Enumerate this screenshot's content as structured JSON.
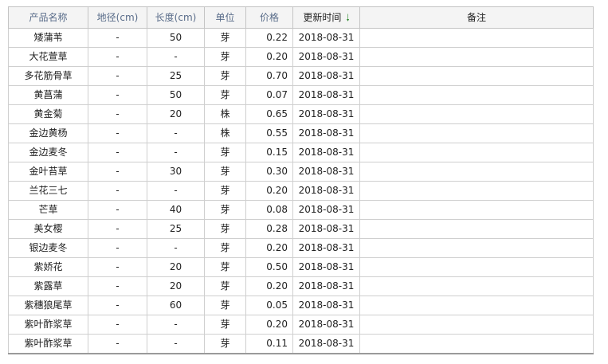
{
  "table": {
    "headers": {
      "name": "产品名称",
      "diameter": "地径(cm)",
      "length": "长度(cm)",
      "unit": "单位",
      "price": "价格",
      "updated": "更新时间",
      "remark": "备注"
    },
    "sort_icon": "arrow-down-icon",
    "sort_color": "#2e8b2e",
    "rows": [
      {
        "name": "矮蒲苇",
        "diameter": "-",
        "length": "50",
        "unit": "芽",
        "price": "0.22",
        "updated": "2018-08-31",
        "remark": ""
      },
      {
        "name": "大花萱草",
        "diameter": "-",
        "length": "-",
        "unit": "芽",
        "price": "0.20",
        "updated": "2018-08-31",
        "remark": ""
      },
      {
        "name": "多花筋骨草",
        "diameter": "-",
        "length": "25",
        "unit": "芽",
        "price": "0.70",
        "updated": "2018-08-31",
        "remark": ""
      },
      {
        "name": "黄菖蒲",
        "diameter": "-",
        "length": "50",
        "unit": "芽",
        "price": "0.07",
        "updated": "2018-08-31",
        "remark": ""
      },
      {
        "name": "黄金菊",
        "diameter": "-",
        "length": "20",
        "unit": "株",
        "price": "0.65",
        "updated": "2018-08-31",
        "remark": ""
      },
      {
        "name": "金边黄杨",
        "diameter": "-",
        "length": "-",
        "unit": "株",
        "price": "0.55",
        "updated": "2018-08-31",
        "remark": ""
      },
      {
        "name": "金边麦冬",
        "diameter": "-",
        "length": "-",
        "unit": "芽",
        "price": "0.15",
        "updated": "2018-08-31",
        "remark": ""
      },
      {
        "name": "金叶苔草",
        "diameter": "-",
        "length": "30",
        "unit": "芽",
        "price": "0.30",
        "updated": "2018-08-31",
        "remark": ""
      },
      {
        "name": "兰花三七",
        "diameter": "-",
        "length": "-",
        "unit": "芽",
        "price": "0.20",
        "updated": "2018-08-31",
        "remark": ""
      },
      {
        "name": "芒草",
        "diameter": "-",
        "length": "40",
        "unit": "芽",
        "price": "0.08",
        "updated": "2018-08-31",
        "remark": ""
      },
      {
        "name": "美女樱",
        "diameter": "-",
        "length": "25",
        "unit": "芽",
        "price": "0.28",
        "updated": "2018-08-31",
        "remark": ""
      },
      {
        "name": "银边麦冬",
        "diameter": "-",
        "length": "-",
        "unit": "芽",
        "price": "0.20",
        "updated": "2018-08-31",
        "remark": ""
      },
      {
        "name": "紫娇花",
        "diameter": "-",
        "length": "20",
        "unit": "芽",
        "price": "0.50",
        "updated": "2018-08-31",
        "remark": ""
      },
      {
        "name": "紫露草",
        "diameter": "-",
        "length": "20",
        "unit": "芽",
        "price": "0.20",
        "updated": "2018-08-31",
        "remark": ""
      },
      {
        "name": "紫穗狼尾草",
        "diameter": "-",
        "length": "60",
        "unit": "芽",
        "price": "0.05",
        "updated": "2018-08-31",
        "remark": ""
      },
      {
        "name": "紫叶酢浆草",
        "diameter": "-",
        "length": "-",
        "unit": "芽",
        "price": "0.20",
        "updated": "2018-08-31",
        "remark": ""
      },
      {
        "name": "紫叶酢浆草",
        "diameter": "-",
        "length": "-",
        "unit": "芽",
        "price": "0.11",
        "updated": "2018-08-31",
        "remark": ""
      }
    ]
  }
}
